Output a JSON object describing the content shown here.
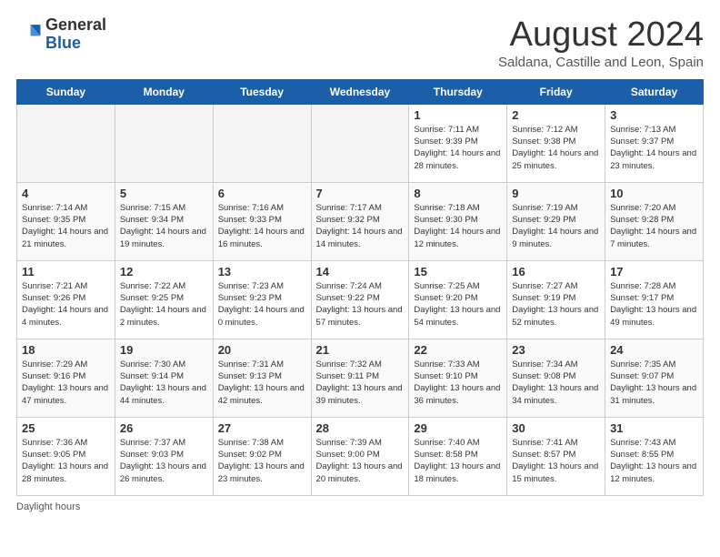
{
  "header": {
    "logo_general": "General",
    "logo_blue": "Blue",
    "month_title": "August 2024",
    "location": "Saldana, Castille and Leon, Spain"
  },
  "days_of_week": [
    "Sunday",
    "Monday",
    "Tuesday",
    "Wednesday",
    "Thursday",
    "Friday",
    "Saturday"
  ],
  "footer": {
    "daylight_hours": "Daylight hours"
  },
  "weeks": [
    [
      {
        "day": "",
        "empty": true
      },
      {
        "day": "",
        "empty": true
      },
      {
        "day": "",
        "empty": true
      },
      {
        "day": "",
        "empty": true
      },
      {
        "day": "1",
        "sunrise": "7:11 AM",
        "sunset": "9:39 PM",
        "daylight": "14 hours and 28 minutes."
      },
      {
        "day": "2",
        "sunrise": "7:12 AM",
        "sunset": "9:38 PM",
        "daylight": "14 hours and 25 minutes."
      },
      {
        "day": "3",
        "sunrise": "7:13 AM",
        "sunset": "9:37 PM",
        "daylight": "14 hours and 23 minutes."
      }
    ],
    [
      {
        "day": "4",
        "sunrise": "7:14 AM",
        "sunset": "9:35 PM",
        "daylight": "14 hours and 21 minutes."
      },
      {
        "day": "5",
        "sunrise": "7:15 AM",
        "sunset": "9:34 PM",
        "daylight": "14 hours and 19 minutes."
      },
      {
        "day": "6",
        "sunrise": "7:16 AM",
        "sunset": "9:33 PM",
        "daylight": "14 hours and 16 minutes."
      },
      {
        "day": "7",
        "sunrise": "7:17 AM",
        "sunset": "9:32 PM",
        "daylight": "14 hours and 14 minutes."
      },
      {
        "day": "8",
        "sunrise": "7:18 AM",
        "sunset": "9:30 PM",
        "daylight": "14 hours and 12 minutes."
      },
      {
        "day": "9",
        "sunrise": "7:19 AM",
        "sunset": "9:29 PM",
        "daylight": "14 hours and 9 minutes."
      },
      {
        "day": "10",
        "sunrise": "7:20 AM",
        "sunset": "9:28 PM",
        "daylight": "14 hours and 7 minutes."
      }
    ],
    [
      {
        "day": "11",
        "sunrise": "7:21 AM",
        "sunset": "9:26 PM",
        "daylight": "14 hours and 4 minutes."
      },
      {
        "day": "12",
        "sunrise": "7:22 AM",
        "sunset": "9:25 PM",
        "daylight": "14 hours and 2 minutes."
      },
      {
        "day": "13",
        "sunrise": "7:23 AM",
        "sunset": "9:23 PM",
        "daylight": "14 hours and 0 minutes."
      },
      {
        "day": "14",
        "sunrise": "7:24 AM",
        "sunset": "9:22 PM",
        "daylight": "13 hours and 57 minutes."
      },
      {
        "day": "15",
        "sunrise": "7:25 AM",
        "sunset": "9:20 PM",
        "daylight": "13 hours and 54 minutes."
      },
      {
        "day": "16",
        "sunrise": "7:27 AM",
        "sunset": "9:19 PM",
        "daylight": "13 hours and 52 minutes."
      },
      {
        "day": "17",
        "sunrise": "7:28 AM",
        "sunset": "9:17 PM",
        "daylight": "13 hours and 49 minutes."
      }
    ],
    [
      {
        "day": "18",
        "sunrise": "7:29 AM",
        "sunset": "9:16 PM",
        "daylight": "13 hours and 47 minutes."
      },
      {
        "day": "19",
        "sunrise": "7:30 AM",
        "sunset": "9:14 PM",
        "daylight": "13 hours and 44 minutes."
      },
      {
        "day": "20",
        "sunrise": "7:31 AM",
        "sunset": "9:13 PM",
        "daylight": "13 hours and 42 minutes."
      },
      {
        "day": "21",
        "sunrise": "7:32 AM",
        "sunset": "9:11 PM",
        "daylight": "13 hours and 39 minutes."
      },
      {
        "day": "22",
        "sunrise": "7:33 AM",
        "sunset": "9:10 PM",
        "daylight": "13 hours and 36 minutes."
      },
      {
        "day": "23",
        "sunrise": "7:34 AM",
        "sunset": "9:08 PM",
        "daylight": "13 hours and 34 minutes."
      },
      {
        "day": "24",
        "sunrise": "7:35 AM",
        "sunset": "9:07 PM",
        "daylight": "13 hours and 31 minutes."
      }
    ],
    [
      {
        "day": "25",
        "sunrise": "7:36 AM",
        "sunset": "9:05 PM",
        "daylight": "13 hours and 28 minutes."
      },
      {
        "day": "26",
        "sunrise": "7:37 AM",
        "sunset": "9:03 PM",
        "daylight": "13 hours and 26 minutes."
      },
      {
        "day": "27",
        "sunrise": "7:38 AM",
        "sunset": "9:02 PM",
        "daylight": "13 hours and 23 minutes."
      },
      {
        "day": "28",
        "sunrise": "7:39 AM",
        "sunset": "9:00 PM",
        "daylight": "13 hours and 20 minutes."
      },
      {
        "day": "29",
        "sunrise": "7:40 AM",
        "sunset": "8:58 PM",
        "daylight": "13 hours and 18 minutes."
      },
      {
        "day": "30",
        "sunrise": "7:41 AM",
        "sunset": "8:57 PM",
        "daylight": "13 hours and 15 minutes."
      },
      {
        "day": "31",
        "sunrise": "7:43 AM",
        "sunset": "8:55 PM",
        "daylight": "13 hours and 12 minutes."
      }
    ]
  ]
}
